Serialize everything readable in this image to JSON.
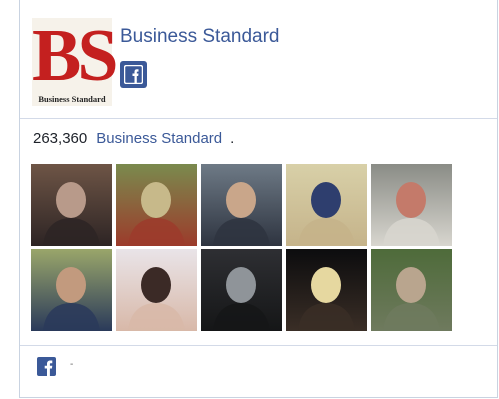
{
  "page": {
    "name": "Business Standard",
    "logo_text": "BS",
    "logo_subtext": "Business Standard"
  },
  "stats": {
    "likes_count": "263,360",
    "page_link": "Business Standard",
    "suffix": "."
  },
  "faces": [
    {
      "name": "face-1",
      "colors": [
        "#6e5546",
        "#b89a8a",
        "#2d2424"
      ]
    },
    {
      "name": "face-2",
      "colors": [
        "#7a8a4e",
        "#c7b98a",
        "#9c3b2b"
      ]
    },
    {
      "name": "face-3",
      "colors": [
        "#6e7a86",
        "#c9a68a",
        "#2e3440"
      ]
    },
    {
      "name": "face-4",
      "colors": [
        "#d8d0a8",
        "#2e3e6e",
        "#c5b38a"
      ]
    },
    {
      "name": "face-5",
      "colors": [
        "#8a8c86",
        "#c47a6a",
        "#d8d6cf"
      ]
    },
    {
      "name": "face-6",
      "colors": [
        "#9aa66a",
        "#c29a7e",
        "#2a3a5a"
      ]
    },
    {
      "name": "face-7",
      "colors": [
        "#e9e4e8",
        "#3b2a26",
        "#d8b8a8"
      ]
    },
    {
      "name": "face-8",
      "colors": [
        "#2e2f33",
        "#8f9499",
        "#151617"
      ]
    },
    {
      "name": "face-9",
      "colors": [
        "#0c0c0e",
        "#e6d8a0",
        "#3a2e26"
      ]
    },
    {
      "name": "face-10",
      "colors": [
        "#4e6b3a",
        "#b9a58e",
        "#6f7a5e"
      ]
    }
  ],
  "footer": {
    "dash": "-"
  },
  "colors": {
    "facebook_blue": "#3b5998",
    "border": "#c9d3e1",
    "logo_red": "#c4201f"
  }
}
